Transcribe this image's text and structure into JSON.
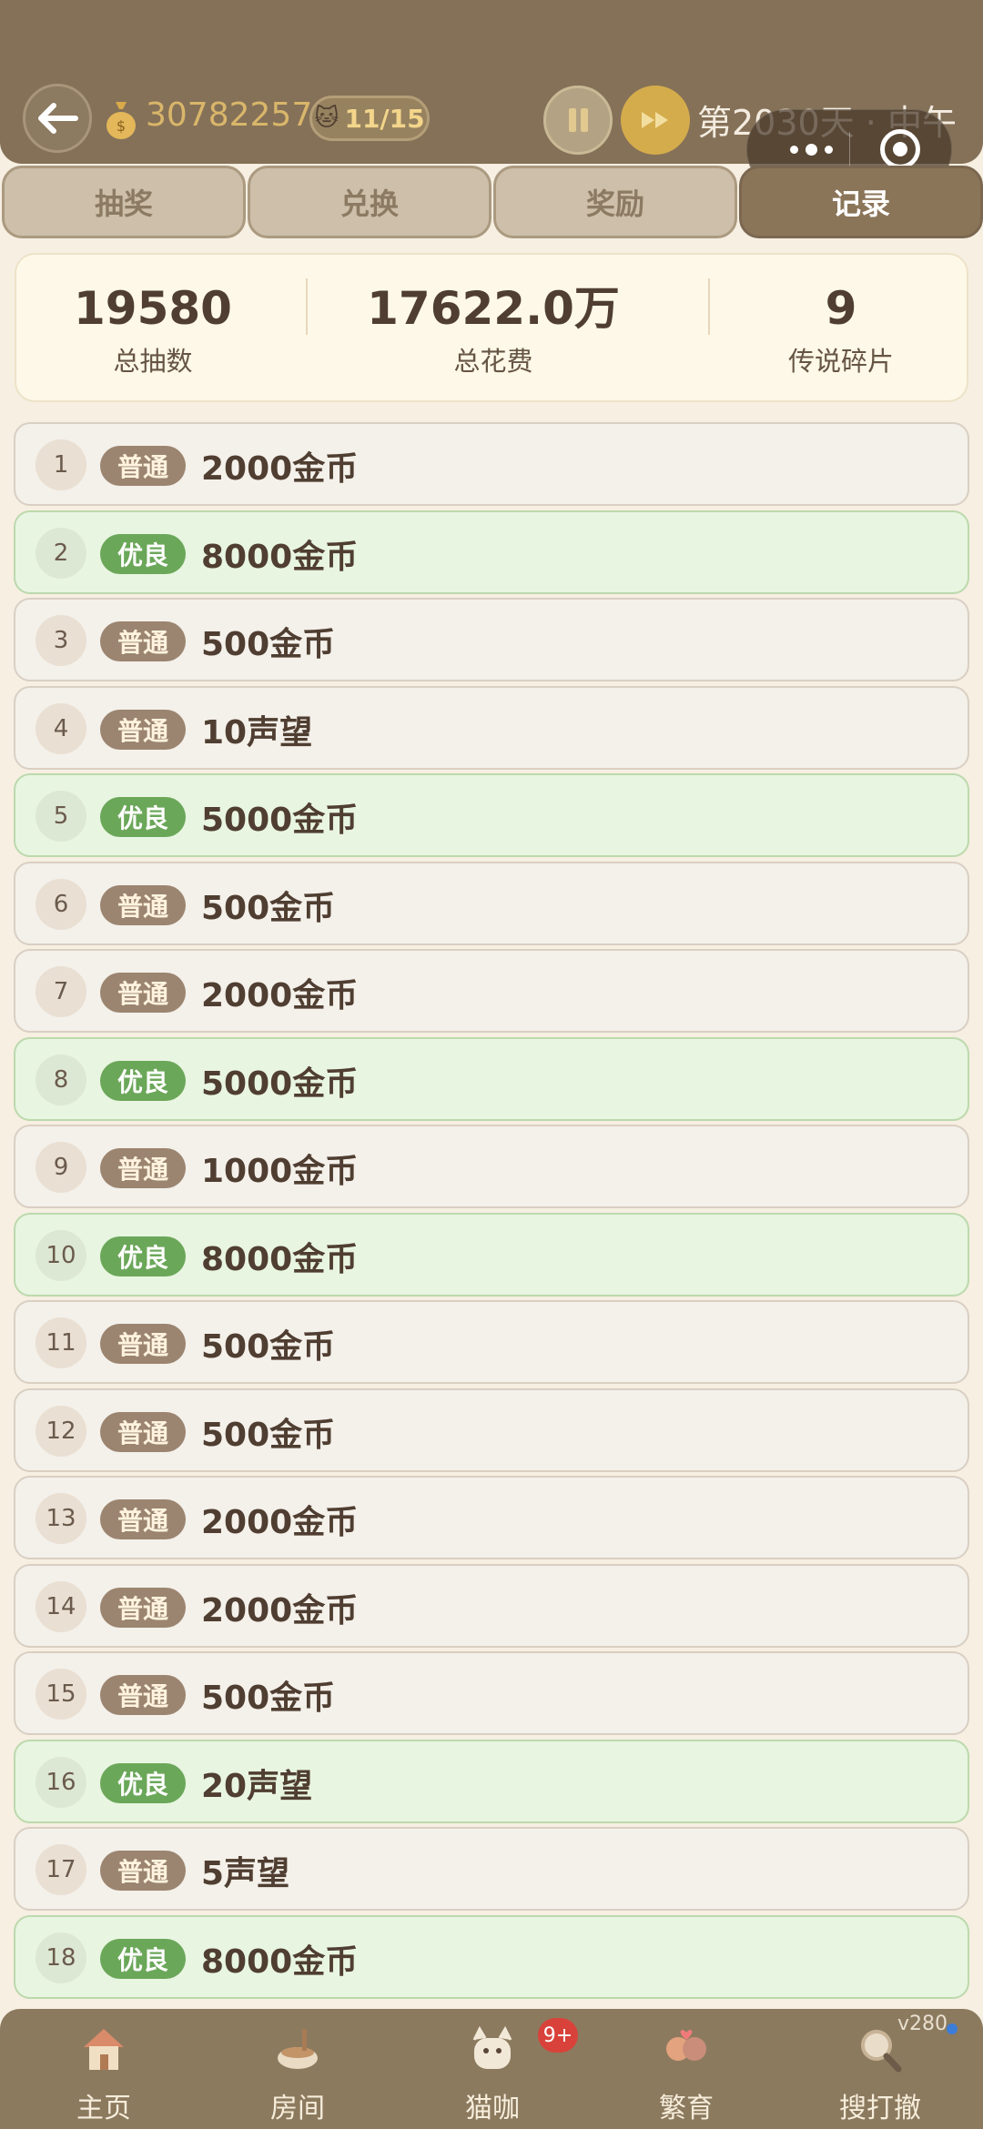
{
  "header": {
    "coins": "30782257",
    "cat_count": "11/15",
    "day_text": "第2030天 · 中午"
  },
  "tabs": [
    {
      "label": "抽奖",
      "active": false
    },
    {
      "label": "兑换",
      "active": false
    },
    {
      "label": "奖励",
      "active": false
    },
    {
      "label": "记录",
      "active": true
    }
  ],
  "stats": {
    "total_draws": {
      "value": "19580",
      "label": "总抽数"
    },
    "total_cost": {
      "value": "17622.0万",
      "label": "总花费"
    },
    "legend_shards": {
      "value": "9",
      "label": "传说碎片"
    }
  },
  "records": [
    {
      "index": "1",
      "tier": "普通",
      "reward": "2000金币"
    },
    {
      "index": "2",
      "tier": "优良",
      "reward": "8000金币"
    },
    {
      "index": "3",
      "tier": "普通",
      "reward": "500金币"
    },
    {
      "index": "4",
      "tier": "普通",
      "reward": "10声望"
    },
    {
      "index": "5",
      "tier": "优良",
      "reward": "5000金币"
    },
    {
      "index": "6",
      "tier": "普通",
      "reward": "500金币"
    },
    {
      "index": "7",
      "tier": "普通",
      "reward": "2000金币"
    },
    {
      "index": "8",
      "tier": "优良",
      "reward": "5000金币"
    },
    {
      "index": "9",
      "tier": "普通",
      "reward": "1000金币"
    },
    {
      "index": "10",
      "tier": "优良",
      "reward": "8000金币"
    },
    {
      "index": "11",
      "tier": "普通",
      "reward": "500金币"
    },
    {
      "index": "12",
      "tier": "普通",
      "reward": "500金币"
    },
    {
      "index": "13",
      "tier": "普通",
      "reward": "2000金币"
    },
    {
      "index": "14",
      "tier": "普通",
      "reward": "2000金币"
    },
    {
      "index": "15",
      "tier": "普通",
      "reward": "500金币"
    },
    {
      "index": "16",
      "tier": "优良",
      "reward": "20声望"
    },
    {
      "index": "17",
      "tier": "普通",
      "reward": "5声望"
    },
    {
      "index": "18",
      "tier": "优良",
      "reward": "8000金币"
    }
  ],
  "bottom_nav": {
    "items": [
      {
        "label": "主页",
        "icon": "house-icon"
      },
      {
        "label": "房间",
        "icon": "bowl-icon"
      },
      {
        "label": "猫咖",
        "icon": "cat-cup-icon"
      },
      {
        "label": "繁育",
        "icon": "cat-couple-icon"
      },
      {
        "label": "搜打撤",
        "icon": "magnifier-icon"
      }
    ],
    "cafe_badge": "9+",
    "version": "v280"
  },
  "colors": {
    "header_bg": "#857158",
    "normal_badge": "#9b8570",
    "good_badge": "#6ba759",
    "good_row_bg": "#e8f5e1",
    "normal_row_bg": "#f4f0ea",
    "accent_gold": "#d4ac4c"
  }
}
